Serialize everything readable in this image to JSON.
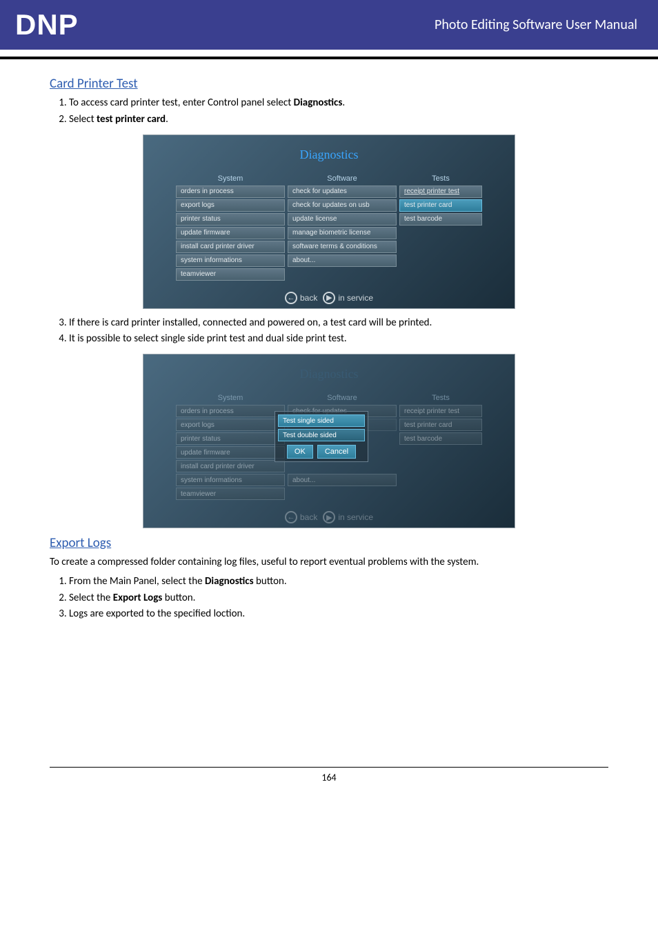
{
  "header": {
    "logo": "DNP",
    "title": "Photo Editing Software User Manual"
  },
  "sections": {
    "card_printer_test": {
      "title": "Card Printer Test",
      "steps_a": [
        "To access card printer test, enter Control panel select Diagnostics.",
        "Select test printer card."
      ],
      "steps_b": [
        "If there is card printer installed, connected and powered on, a test card will be printed.",
        "It is possible to select single side print test and dual side print test."
      ]
    },
    "export_logs": {
      "title": "Export Logs",
      "intro": "To create a compressed folder containing log files, useful to report eventual problems with the system.",
      "steps": [
        "From the Main Panel, select the Diagnostics button.",
        "Select the Export Logs button.",
        "Logs are exported to the specified loction."
      ]
    }
  },
  "bold": {
    "diagnostics": "Diagnostics",
    "test_printer_card": "test printer card",
    "export_logs": "Export Logs"
  },
  "diag1": {
    "title": "Diagnostics",
    "cols": {
      "system": "System",
      "software": "Software",
      "tests": "Tests"
    },
    "system_items": [
      "orders in process",
      "export logs",
      "printer status",
      "update firmware",
      "install card printer driver",
      "system informations",
      "teamviewer"
    ],
    "software_items": [
      "check for updates",
      "check for updates on usb",
      "update license",
      "manage biometric license",
      "software terms & conditions",
      "about..."
    ],
    "tests_items": [
      "receipt printer test",
      "test printer card",
      "test barcode"
    ],
    "back": "back",
    "in_service": "in service"
  },
  "diag2": {
    "title": "Diagnostics",
    "popup": {
      "single": "Test single sided",
      "double": "Test double sided",
      "ok": "OK",
      "cancel": "Cancel"
    },
    "back": "back",
    "in_service": "in service"
  },
  "page_number": "164"
}
